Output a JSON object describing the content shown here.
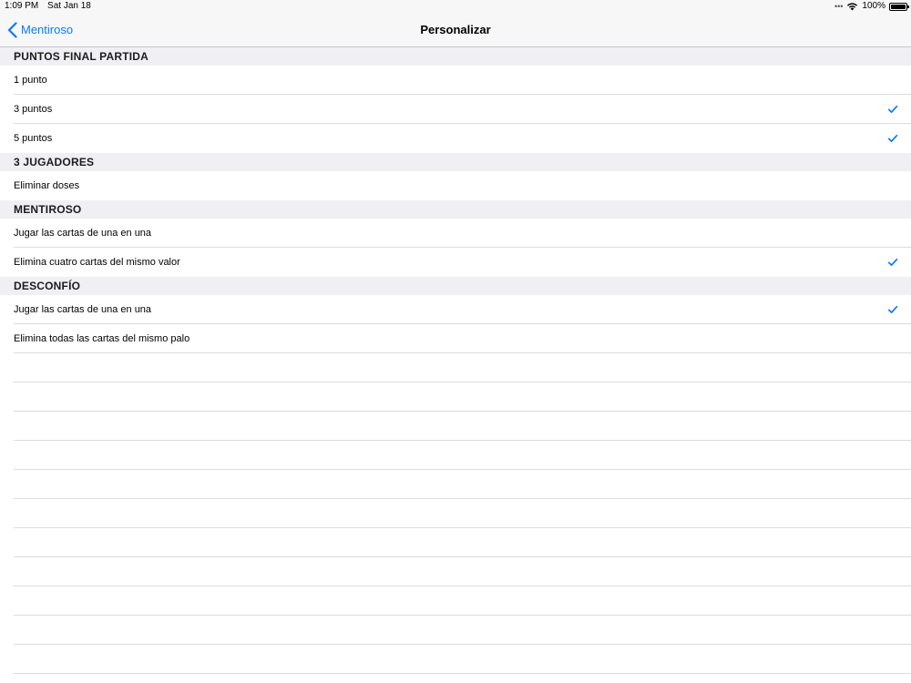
{
  "status": {
    "time": "1:09 PM",
    "date": "Sat Jan 18",
    "battery": "100%",
    "battery_level": 1.0
  },
  "nav": {
    "back_label": "Mentiroso",
    "title": "Personalizar"
  },
  "sections": [
    {
      "header": "PUNTOS FINAL PARTIDA",
      "rows": [
        {
          "label": "1 punto",
          "checked": false
        },
        {
          "label": "3 puntos",
          "checked": true
        },
        {
          "label": "5 puntos",
          "checked": true
        }
      ]
    },
    {
      "header": "3 JUGADORES",
      "rows": [
        {
          "label": "Eliminar doses",
          "checked": false
        }
      ]
    },
    {
      "header": "MENTIROSO",
      "rows": [
        {
          "label": "Jugar las cartas de una en una",
          "checked": false
        },
        {
          "label": "Elimina cuatro cartas del mismo valor",
          "checked": true
        }
      ]
    },
    {
      "header": "DESCONFÍO",
      "rows": [
        {
          "label": "Jugar las cartas de una en una",
          "checked": true
        },
        {
          "label": "Elimina todas las cartas del mismo palo",
          "checked": false
        }
      ]
    }
  ],
  "colors": {
    "accent": "#0a7aff",
    "section_background": "#f0f0f4",
    "separator": "#dcdce0"
  },
  "icons": {
    "back": "chevron-left-icon",
    "check": "checkmark-icon",
    "wifi": "wifi-icon",
    "battery": "battery-icon"
  }
}
